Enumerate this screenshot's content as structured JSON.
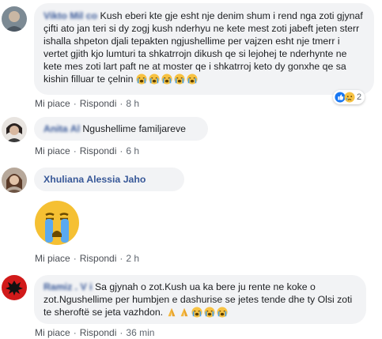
{
  "comments": [
    {
      "author": "Vikto  Mil   co",
      "text": "Kush eberi kte gje esht nje denim shum i rend nga zoti gjynaf çifti ato jan teri si dy zogj kush nderhyu ne kete mest zoti jabeft jeten sterr ishalla shpeton djali tepakten ngjushellime per vajzen esht nje tmerr i vertet gjith kjo lumturi ta shkatrrojn dikush qe si lejohej te nderhynte ne kete mes zoti lart paft ne at moster qe i shkatrroj keto dy gonxhe qe sa kishin filluar te çelnin",
      "emojis": [
        "crying-face-icon",
        "crying-face-icon",
        "crying-face-icon",
        "crying-face-icon",
        "crying-face-icon"
      ],
      "like": "Mi piace",
      "reply": "Rispondi",
      "time": "8 h",
      "reactions_count": "2"
    },
    {
      "author": "Anita Al   ",
      "text": "Ngushellime familjareve",
      "like": "Mi piace",
      "reply": "Rispondi",
      "time": "6 h"
    },
    {
      "author": "Xhuliana Alessia Jaho",
      "emoji": "big-crying-face-icon",
      "like": "Mi piace",
      "reply": "Rispondi",
      "time": "2 h"
    },
    {
      "author": "Ramiz   . V    i",
      "text": "Sa gjynah o zot.Kush ua ka bere ju rente ne koke o zot.Ngushellime per humbjen e dashurise se jetes tende dhe ty Olsi zoti te sheroftë se jeta vazhdon.",
      "emojis": [
        "praying-hands-icon",
        "praying-hands-icon",
        "crying-face-icon",
        "crying-face-icon",
        "crying-face-icon"
      ],
      "like": "Mi piace",
      "reply": "Rispondi",
      "time": "36 min"
    }
  ],
  "colors": {
    "link": "#385898",
    "bubble": "#f2f3f5",
    "meta": "#606770"
  }
}
